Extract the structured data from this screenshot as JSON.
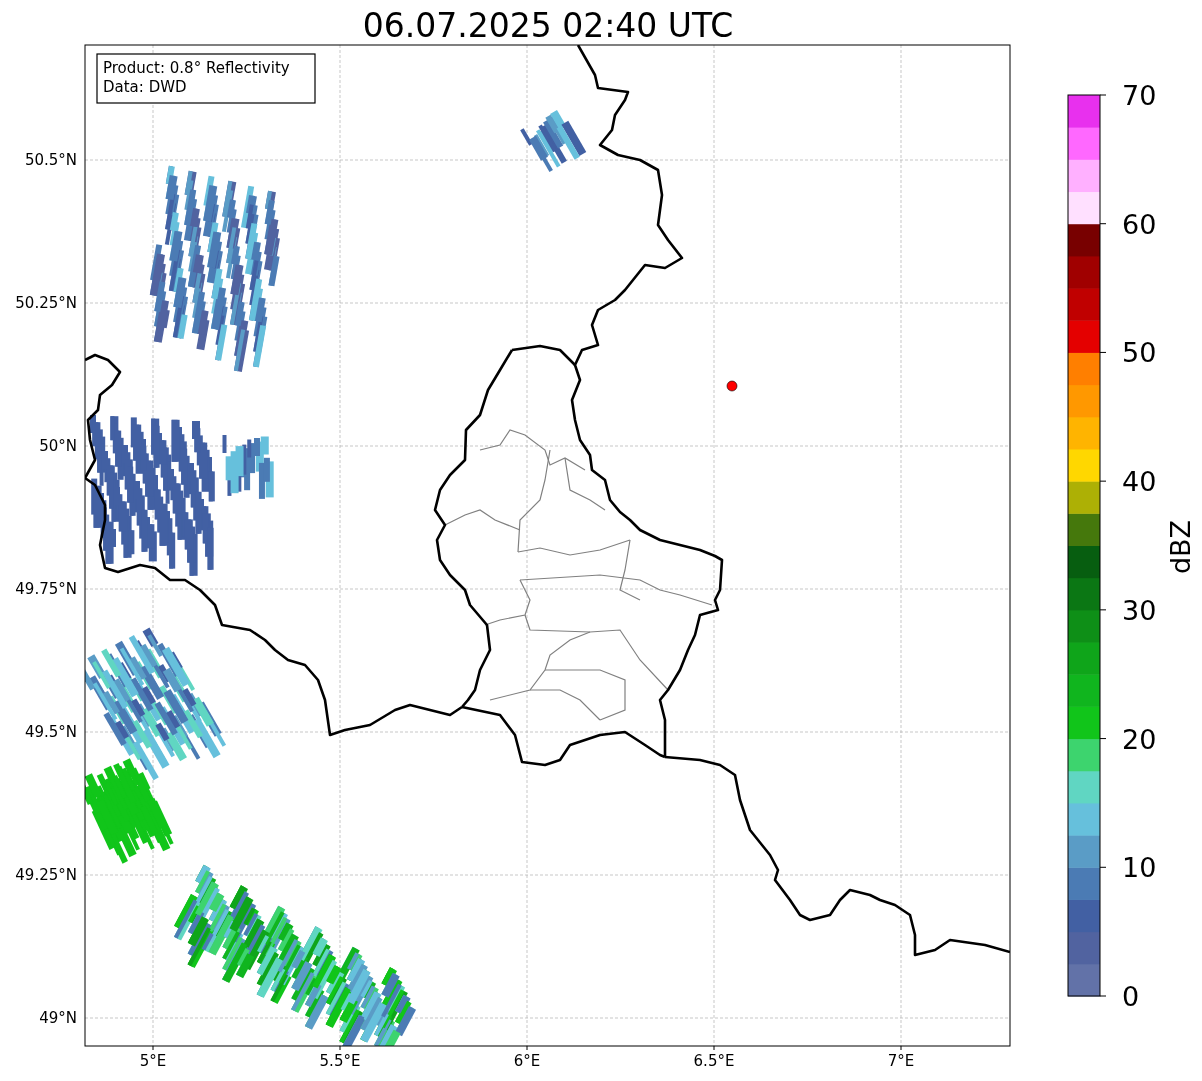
{
  "title": "06.07.2025 02:40 UTC",
  "info_box": [
    "Product: 0.8° Reflectivity",
    "Data: DWD"
  ],
  "map": {
    "xticks": [
      "5°E",
      "5.5°E",
      "6°E",
      "6.5°E",
      "7°E"
    ],
    "yticks": [
      "50.5°N",
      "50.25°N",
      "50°N",
      "49.75°N",
      "49.5°N",
      "49.25°N",
      "49°N"
    ]
  },
  "colorbar": {
    "label": "dBZ",
    "ticks": [
      "70",
      "60",
      "50",
      "40",
      "30",
      "20",
      "10",
      "0"
    ]
  }
}
